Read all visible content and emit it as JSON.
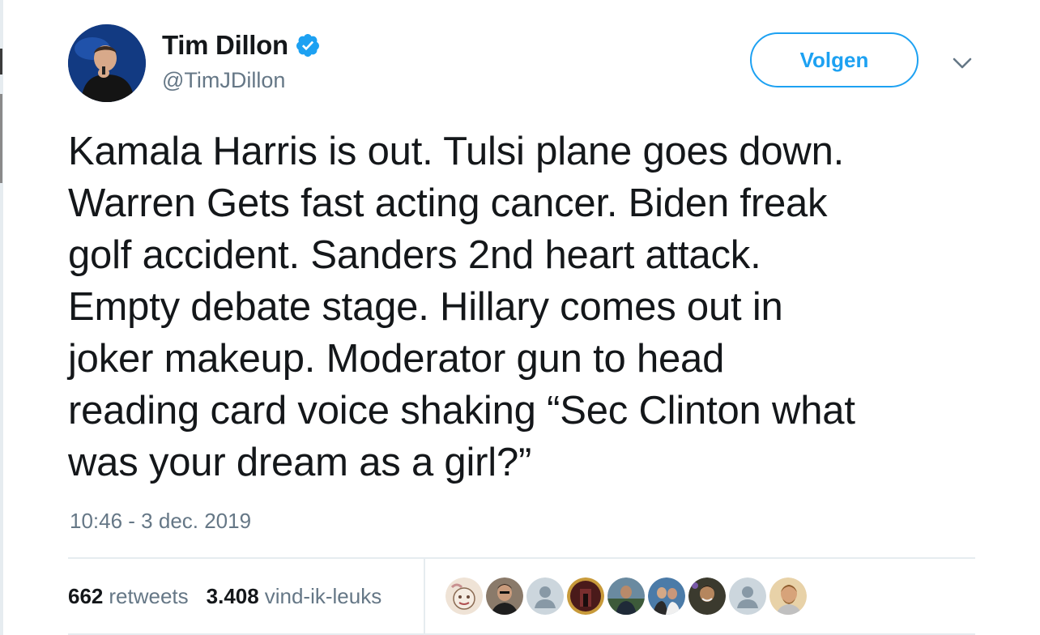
{
  "profile": {
    "name": "Tim Dillon",
    "handle": "@TimJDillon",
    "verified": true,
    "avatar_icon": "user-avatar"
  },
  "follow_button": {
    "label": "Volgen"
  },
  "menu": {
    "icon": "chevron-down-icon"
  },
  "tweet": {
    "text": "Kamala Harris is out. Tulsi plane goes down.\nWarren Gets fast acting cancer. Biden freak\ngolf accident. Sanders 2nd heart attack.\nEmpty debate stage. Hillary comes out in\njoker makeup. Moderator gun to head\nreading card voice shaking “Sec Clinton what\nwas your dream as a girl?”",
    "timestamp": "10:46 - 3 dec. 2019"
  },
  "stats": {
    "retweets": {
      "count": "662",
      "label": "retweets"
    },
    "likes": {
      "count": "3.408",
      "label": "vind-ik-leuks"
    }
  },
  "likers": [
    {
      "icon": "cartoon-avatar",
      "color": "#e8d6c8"
    },
    {
      "icon": "photo-avatar",
      "color": "#5a4a3e"
    },
    {
      "icon": "default-avatar",
      "color": "#c8d1d9"
    },
    {
      "icon": "photo-avatar",
      "color": "#7a2a2a"
    },
    {
      "icon": "photo-avatar",
      "color": "#3d5a3a"
    },
    {
      "icon": "photo-avatar",
      "color": "#2f4f6e"
    },
    {
      "icon": "photo-avatar",
      "color": "#3a3a2f"
    },
    {
      "icon": "default-avatar",
      "color": "#c8d1d9"
    },
    {
      "icon": "photo-avatar",
      "color": "#c9a06a"
    }
  ],
  "colors": {
    "accent": "#1da1f2",
    "text": "#14171a",
    "muted": "#657786",
    "divider": "#e6ecf0"
  }
}
